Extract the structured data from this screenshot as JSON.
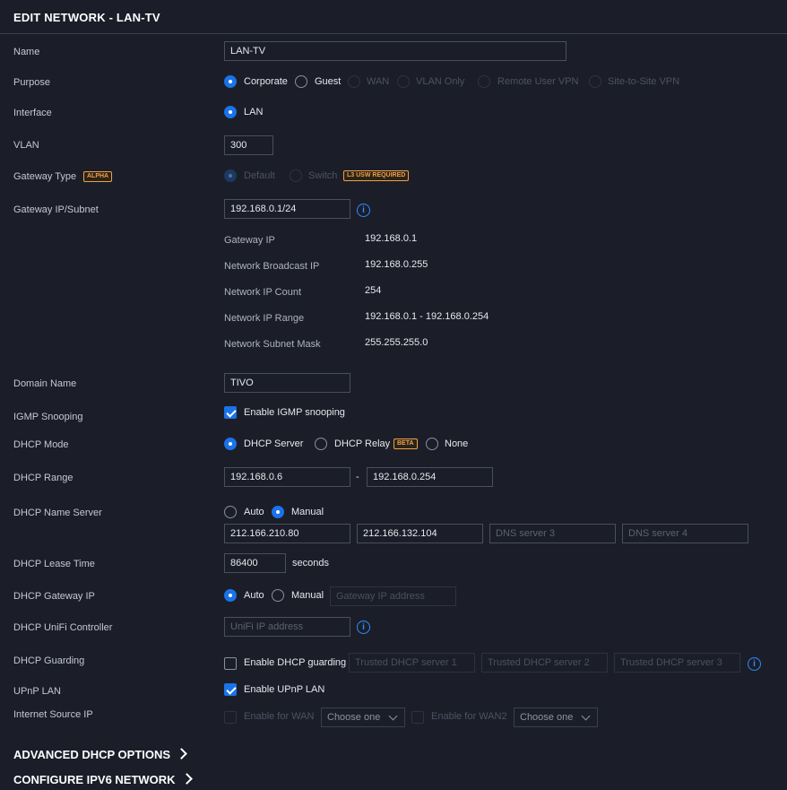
{
  "title": "EDIT NETWORK - LAN-TV",
  "fields": {
    "name": {
      "label": "Name",
      "value": "LAN-TV"
    },
    "purpose": {
      "label": "Purpose",
      "options": [
        "Corporate",
        "Guest",
        "WAN",
        "VLAN Only",
        "Remote User VPN",
        "Site-to-Site VPN"
      ],
      "selected": "Corporate"
    },
    "interface": {
      "label": "Interface",
      "value": "LAN"
    },
    "vlan": {
      "label": "VLAN",
      "value": "300"
    },
    "gateway_type": {
      "label": "Gateway Type",
      "badge": "ALPHA",
      "options": [
        "Default",
        "Switch"
      ],
      "switch_badge": "L3 USW REQUIRED"
    },
    "gateway_ip_subnet": {
      "label": "Gateway IP/Subnet",
      "value": "192.168.0.1/24"
    },
    "subnet_info": [
      {
        "label": "Gateway IP",
        "value": "192.168.0.1"
      },
      {
        "label": "Network Broadcast IP",
        "value": "192.168.0.255"
      },
      {
        "label": "Network IP Count",
        "value": "254"
      },
      {
        "label": "Network IP Range",
        "value": "192.168.0.1 - 192.168.0.254"
      },
      {
        "label": "Network Subnet Mask",
        "value": "255.255.255.0"
      }
    ],
    "domain_name": {
      "label": "Domain Name",
      "value": "TIVO"
    },
    "igmp": {
      "label": "IGMP Snooping",
      "checkbox_label": "Enable IGMP snooping",
      "checked": true
    },
    "dhcp_mode": {
      "label": "DHCP Mode",
      "options": [
        "DHCP Server",
        "DHCP Relay",
        "None"
      ],
      "relay_badge": "BETA",
      "selected": "DHCP Server"
    },
    "dhcp_range": {
      "label": "DHCP Range",
      "start": "192.168.0.6",
      "separator": "-",
      "end": "192.168.0.254"
    },
    "dhcp_name_server": {
      "label": "DHCP Name Server",
      "options": [
        "Auto",
        "Manual"
      ],
      "selected": "Manual",
      "servers": [
        "212.166.210.80",
        "212.166.132.104"
      ],
      "placeholder3": "DNS server 3",
      "placeholder4": "DNS server 4"
    },
    "dhcp_lease_time": {
      "label": "DHCP Lease Time",
      "value": "86400",
      "unit": "seconds"
    },
    "dhcp_gateway_ip": {
      "label": "DHCP Gateway IP",
      "options": [
        "Auto",
        "Manual"
      ],
      "selected": "Auto",
      "placeholder": "Gateway IP address"
    },
    "dhcp_unifi_controller": {
      "label": "DHCP UniFi Controller",
      "placeholder": "UniFi IP address"
    },
    "dhcp_guarding": {
      "label": "DHCP Guarding",
      "checkbox_label": "Enable DHCP guarding",
      "checked": false,
      "placeholders": [
        "Trusted DHCP server 1",
        "Trusted DHCP server 2",
        "Trusted DHCP server 3"
      ]
    },
    "upnp_lan": {
      "label": "UPnP LAN",
      "checkbox_label": "Enable UPnP LAN",
      "checked": true
    },
    "internet_source_ip": {
      "label": "Internet Source IP",
      "wan_label": "Enable for WAN",
      "wan2_label": "Enable for WAN2",
      "select_text": "Choose one"
    }
  },
  "sections": {
    "advanced_dhcp": "ADVANCED DHCP OPTIONS",
    "ipv6": "CONFIGURE IPV6 NETWORK"
  },
  "colors": {
    "background": "#1b1e29",
    "accent": "#1a73e8",
    "badge": "#f0a04b"
  }
}
